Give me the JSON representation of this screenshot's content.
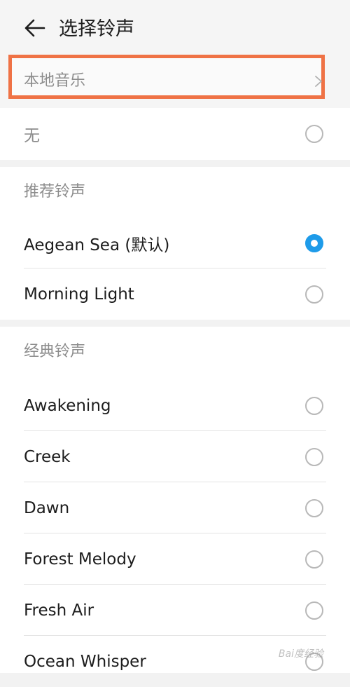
{
  "header": {
    "title": "选择铃声",
    "back_icon": "arrow-left-icon"
  },
  "local_music": {
    "label": "本地音乐",
    "icon": "chevron-right-icon",
    "highlight_color": "#ef7245"
  },
  "none_option": {
    "label": "无",
    "selected": false
  },
  "recommended": {
    "section_label": "推荐铃声",
    "items": [
      {
        "label": "Aegean Sea (默认)",
        "selected": true
      },
      {
        "label": "Morning Light",
        "selected": false
      }
    ]
  },
  "classic": {
    "section_label": "经典铃声",
    "items": [
      {
        "label": "Awakening",
        "selected": false
      },
      {
        "label": "Creek",
        "selected": false
      },
      {
        "label": "Dawn",
        "selected": false
      },
      {
        "label": "Forest Melody",
        "selected": false
      },
      {
        "label": "Fresh Air",
        "selected": false
      },
      {
        "label": "Ocean Whisper",
        "selected": false
      }
    ]
  },
  "accent_color": "#1e9be9",
  "watermark": "Bai度经验"
}
